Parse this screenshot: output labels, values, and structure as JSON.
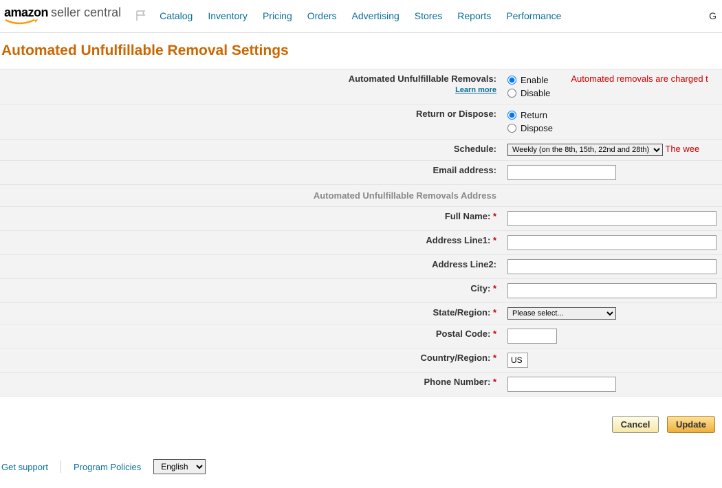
{
  "brand": {
    "word1": "amazon",
    "word2": "seller central"
  },
  "nav": [
    "Catalog",
    "Inventory",
    "Pricing",
    "Orders",
    "Advertising",
    "Stores",
    "Reports",
    "Performance"
  ],
  "right_letter": "G",
  "page_title": "Automated Unfulfillable Removal Settings",
  "labels": {
    "auto_removals": "Automated Unfulfillable Removals:",
    "learn_more": "Learn more",
    "return_dispose": "Return or Dispose:",
    "schedule": "Schedule:",
    "email": "Email address:",
    "address_section": "Automated Unfulfillable Removals Address",
    "full_name": "Full Name:",
    "addr1": "Address Line1:",
    "addr2": "Address Line2:",
    "city": "City:",
    "state": "State/Region:",
    "postal": "Postal Code:",
    "country": "Country/Region:",
    "phone": "Phone Number:"
  },
  "options": {
    "enable": "Enable",
    "disable": "Disable",
    "return": "Return",
    "dispose": "Dispose"
  },
  "notes": {
    "charged": "Automated removals are charged t",
    "weekly_note": "The wee"
  },
  "schedule_selected": "Weekly (on the 8th, 15th, 22nd and 28th)",
  "state_placeholder": "Please select...",
  "country_value": "US",
  "buttons": {
    "cancel": "Cancel",
    "update": "Update"
  },
  "footer": {
    "support": "Get support",
    "policies": "Program Policies",
    "lang": "English"
  }
}
